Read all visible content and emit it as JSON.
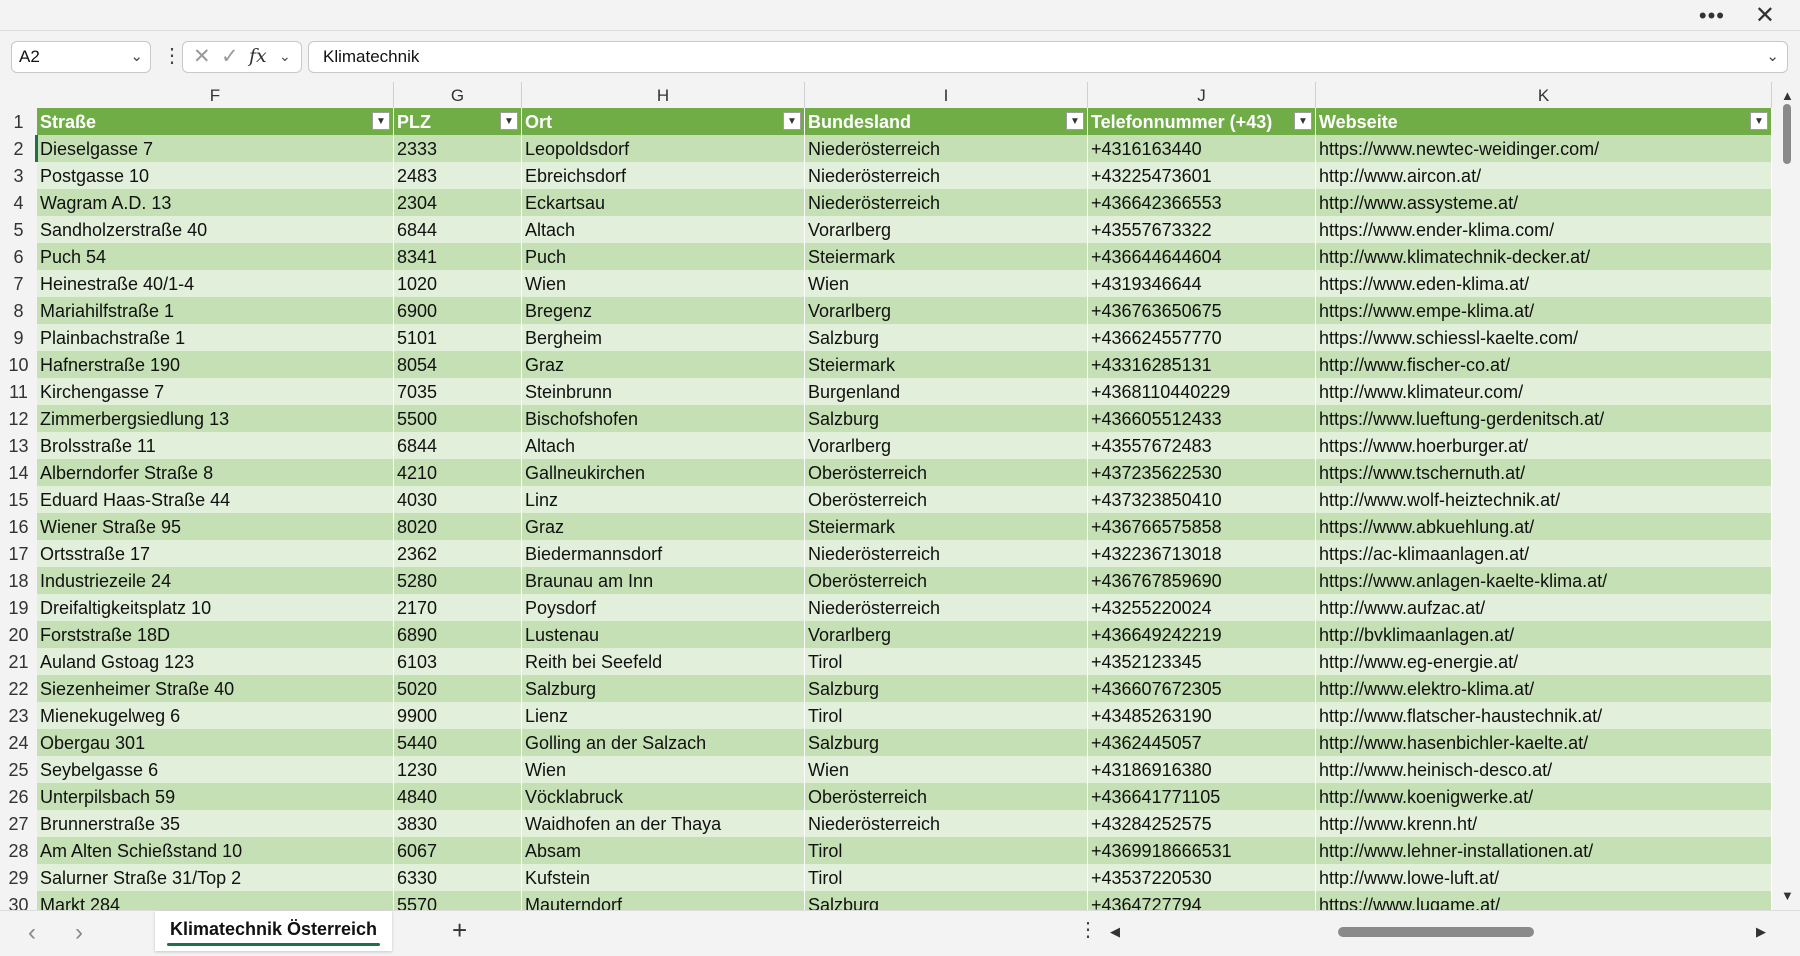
{
  "window": {
    "more_icon": "ellipsis-icon",
    "close_icon": "close-icon"
  },
  "formula_bar": {
    "name_box": "A2",
    "formula": "Klimatechnik"
  },
  "columns": [
    "F",
    "G",
    "H",
    "I",
    "J",
    "K"
  ],
  "headers": [
    "Straße",
    "PLZ",
    "Ort",
    "Bundesland",
    "Telefonnummer (+43)",
    "Webseite"
  ],
  "rows": [
    [
      "2",
      "Dieselgasse 7",
      "2333",
      "Leopoldsdorf",
      "Niederösterreich",
      "+4316163440",
      "https://www.newtec-weidinger.com/"
    ],
    [
      "3",
      "Postgasse 10",
      "2483",
      "Ebreichsdorf",
      "Niederösterreich",
      "+43225473601",
      "http://www.aircon.at/"
    ],
    [
      "4",
      "Wagram A.D. 13",
      "2304",
      "Eckartsau",
      "Niederösterreich",
      "+436642366553",
      "http://www.assysteme.at/"
    ],
    [
      "5",
      "Sandholzerstraße 40",
      "6844",
      "Altach",
      "Vorarlberg",
      "+43557673322",
      "https://www.ender-klima.com/"
    ],
    [
      "6",
      "Puch 54",
      "8341",
      "Puch",
      "Steiermark",
      "+436644644604",
      "http://www.klimatechnik-decker.at/"
    ],
    [
      "7",
      "Heinestraße 40/1-4",
      "1020",
      "Wien",
      "Wien",
      "+4319346644",
      "https://www.eden-klima.at/"
    ],
    [
      "8",
      "Mariahilfstraße 1",
      "6900",
      "Bregenz",
      "Vorarlberg",
      "+436763650675",
      "https://www.empe-klima.at/"
    ],
    [
      "9",
      "Plainbachstraße 1",
      "5101",
      "Bergheim",
      "Salzburg",
      "+436624557770",
      "https://www.schiessl-kaelte.com/"
    ],
    [
      "10",
      "Hafnerstraße 190",
      "8054",
      "Graz",
      "Steiermark",
      "+43316285131",
      "http://www.fischer-co.at/"
    ],
    [
      "11",
      "Kirchengasse 7",
      "7035",
      "Steinbrunn",
      "Burgenland",
      "+4368110440229",
      "http://www.klimateur.com/"
    ],
    [
      "12",
      "Zimmerbergsiedlung 13",
      "5500",
      "Bischofshofen",
      "Salzburg",
      "+436605512433",
      "https://www.lueftung-gerdenitsch.at/"
    ],
    [
      "13",
      "Brolsstraße 11",
      "6844",
      "Altach",
      "Vorarlberg",
      "+43557672483",
      "https://www.hoerburger.at/"
    ],
    [
      "14",
      "Alberndorfer Straße 8",
      "4210",
      "Gallneukirchen",
      "Oberösterreich",
      "+437235622530",
      "https://www.tschernuth.at/"
    ],
    [
      "15",
      "Eduard Haas-Straße 44",
      "4030",
      "Linz",
      "Oberösterreich",
      "+437323850410",
      "http://www.wolf-heiztechnik.at/"
    ],
    [
      "16",
      "Wiener Straße 95",
      "8020",
      "Graz",
      "Steiermark",
      "+436766575858",
      "https://www.abkuehlung.at/"
    ],
    [
      "17",
      "Ortsstraße 17",
      "2362",
      "Biedermannsdorf",
      "Niederösterreich",
      "+432236713018",
      "https://ac-klimaanlagen.at/"
    ],
    [
      "18",
      "Industriezeile 24",
      "5280",
      "Braunau am Inn",
      "Oberösterreich",
      "+436767859690",
      "https://www.anlagen-kaelte-klima.at/"
    ],
    [
      "19",
      "Dreifaltigkeitsplatz 10",
      "2170",
      "Poysdorf",
      "Niederösterreich",
      "+43255220024",
      "http://www.aufzac.at/"
    ],
    [
      "20",
      "Forststraße 18D",
      "6890",
      "Lustenau",
      "Vorarlberg",
      "+436649242219",
      "http://bvklimaanlagen.at/"
    ],
    [
      "21",
      "Auland Gstoag 123",
      "6103",
      "Reith bei Seefeld",
      "Tirol",
      "+4352123345",
      "http://www.eg-energie.at/"
    ],
    [
      "22",
      "Siezenheimer Straße 40",
      "5020",
      "Salzburg",
      "Salzburg",
      "+436607672305",
      "http://www.elektro-klima.at/"
    ],
    [
      "23",
      "Mienekugelweg 6",
      "9900",
      "Lienz",
      "Tirol",
      "+43485263190",
      "http://www.flatscher-haustechnik.at/"
    ],
    [
      "24",
      "Obergau 301",
      "5440",
      "Golling an der Salzach",
      "Salzburg",
      "+4362445057",
      "http://www.hasenbichler-kaelte.at/"
    ],
    [
      "25",
      "Seybelgasse 6",
      "1230",
      "Wien",
      "Wien",
      "+43186916380",
      "http://www.heinisch-desco.at/"
    ],
    [
      "26",
      "Unterpilsbach 59",
      "4840",
      "Vöcklabruck",
      "Oberösterreich",
      "+436641771105",
      "http://www.koenigwerke.at/"
    ],
    [
      "27",
      "Brunnerstraße 35",
      "3830",
      "Waidhofen an der Thaya",
      "Niederösterreich",
      "+43284252575",
      "http://www.krenn.ht/"
    ],
    [
      "28",
      "Am Alten Schießstand 10",
      "6067",
      "Absam",
      "Tirol",
      "+4369918666531",
      "http://www.lehner-installationen.at/"
    ],
    [
      "29",
      "Salurner Straße 31/Top 2",
      "6330",
      "Kufstein",
      "Tirol",
      "+43537220530",
      "http://www.lowe-luft.at/"
    ],
    [
      "30",
      "Markt 284",
      "5570",
      "Mauterndorf",
      "Salzburg",
      "+4364727794",
      "https://www.lugame.at/"
    ]
  ],
  "sheet_tab": "Klimatechnik Österreich",
  "colors": {
    "header": "#70ad47",
    "band_dark": "#c5e0b4",
    "band_light": "#e2efda",
    "accent": "#1e7145"
  }
}
